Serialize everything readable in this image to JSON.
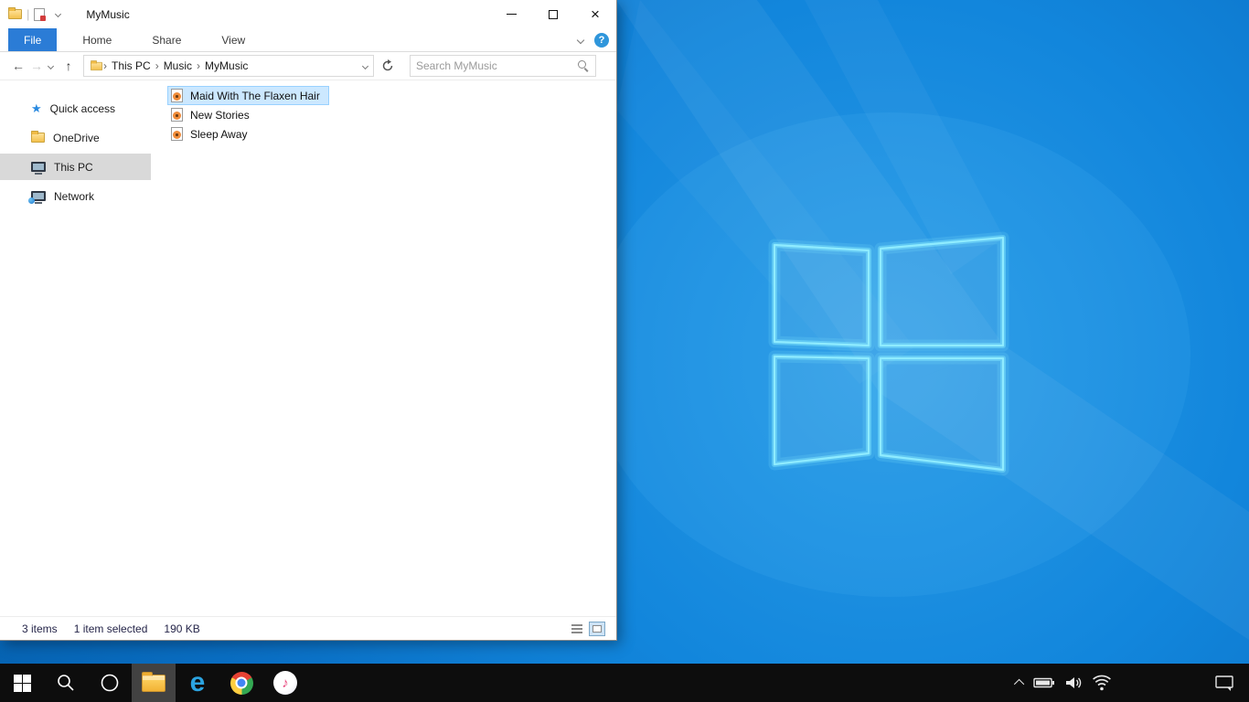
{
  "window": {
    "title": "MyMusic"
  },
  "ribbon": {
    "file_tab": "File",
    "tabs": [
      {
        "label": "Home"
      },
      {
        "label": "Share"
      },
      {
        "label": "View"
      }
    ],
    "help_label": "?"
  },
  "address": {
    "crumbs": [
      {
        "label": "This PC"
      },
      {
        "label": "Music"
      },
      {
        "label": "MyMusic"
      }
    ],
    "search_placeholder": "Search MyMusic"
  },
  "sidebar": {
    "items": [
      {
        "label": "Quick access",
        "icon": "quick-access-star-icon",
        "selected": false
      },
      {
        "label": "OneDrive",
        "icon": "onedrive-icon",
        "selected": false
      },
      {
        "label": "This PC",
        "icon": "this-pc-icon",
        "selected": true
      },
      {
        "label": "Network",
        "icon": "network-icon",
        "selected": false
      }
    ]
  },
  "files": {
    "items": [
      {
        "name": "Maid With The Flaxen Hair",
        "icon": "music-file-icon",
        "selected": true
      },
      {
        "name": "New Stories",
        "icon": "music-file-icon",
        "selected": false
      },
      {
        "name": "Sleep Away",
        "icon": "music-file-icon",
        "selected": false
      }
    ]
  },
  "status": {
    "count": "3 items",
    "selection": "1 item selected",
    "size": "190 KB"
  },
  "taskbar": {
    "buttons": [
      {
        "icon": "start-icon"
      },
      {
        "icon": "search-icon"
      },
      {
        "icon": "cortana-icon"
      },
      {
        "icon": "file-explorer-icon",
        "active": true
      },
      {
        "icon": "edge-icon"
      },
      {
        "icon": "chrome-icon"
      },
      {
        "icon": "itunes-icon"
      }
    ],
    "tray": [
      {
        "icon": "chevron-up-icon"
      },
      {
        "icon": "battery-icon"
      },
      {
        "icon": "volume-icon"
      },
      {
        "icon": "wifi-icon"
      }
    ],
    "action_center_icon": "action-center-icon"
  },
  "colors": {
    "accent": "#0078d7",
    "file_tab_blue": "#2b7cd6",
    "selection_fill": "#cce8ff",
    "selection_border": "#99d1ff",
    "sidebar_selected": "#d9d9d9",
    "taskbar": "#0d0d0d",
    "wallpaper_base": "#0f7ad3"
  }
}
